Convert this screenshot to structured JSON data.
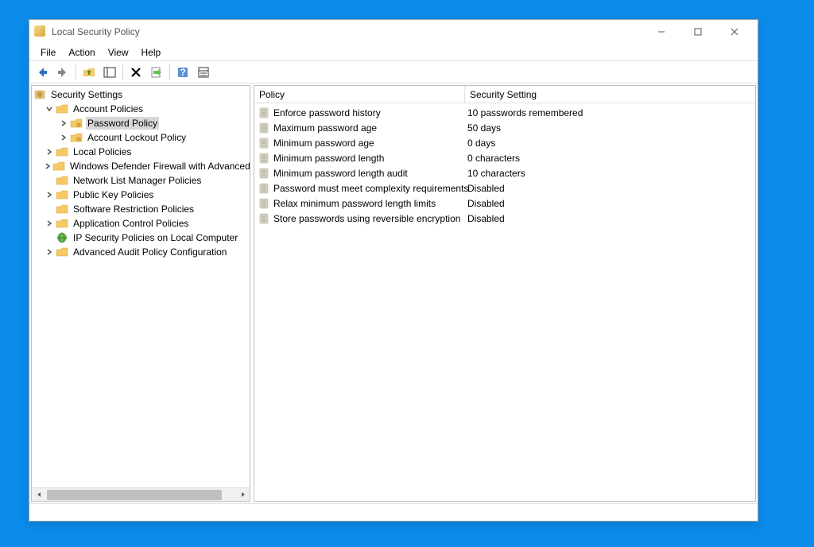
{
  "window": {
    "title": "Local Security Policy"
  },
  "menubar": {
    "items": [
      "File",
      "Action",
      "View",
      "Help"
    ]
  },
  "tree": {
    "root": "Security Settings",
    "account_policies": "Account Policies",
    "password_policy": "Password Policy",
    "account_lockout": "Account Lockout Policy",
    "local_policies": "Local Policies",
    "windows_defender": "Windows Defender Firewall with Advanced Security",
    "network_list": "Network List Manager Policies",
    "public_key": "Public Key Policies",
    "software_restriction": "Software Restriction Policies",
    "app_control": "Application Control Policies",
    "ip_sec": "IP Security Policies on Local Computer",
    "advanced_audit": "Advanced Audit Policy Configuration"
  },
  "columns": {
    "policy": "Policy",
    "setting": "Security Setting"
  },
  "policies": [
    {
      "policy": "Enforce password history",
      "setting": "10 passwords remembered"
    },
    {
      "policy": "Maximum password age",
      "setting": "50 days"
    },
    {
      "policy": "Minimum password age",
      "setting": "0 days"
    },
    {
      "policy": "Minimum password length",
      "setting": "0 characters"
    },
    {
      "policy": "Minimum password length audit",
      "setting": "10 characters"
    },
    {
      "policy": "Password must meet complexity requirements",
      "setting": "Disabled"
    },
    {
      "policy": "Relax minimum password length limits",
      "setting": "Disabled"
    },
    {
      "policy": "Store passwords using reversible encryption",
      "setting": "Disabled"
    }
  ]
}
